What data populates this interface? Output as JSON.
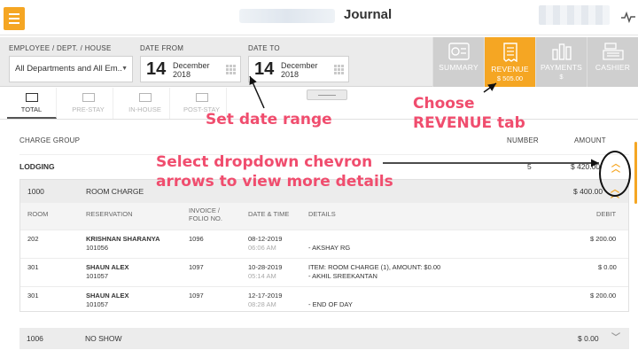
{
  "header": {
    "title": "Journal"
  },
  "filters": {
    "employee_label": "EMPLOYEE / DEPT. / HOUSE",
    "employee_value": "All Departments and All Em..",
    "date_from_label": "DATE FROM",
    "date_from_day": "14",
    "date_from_month": "December",
    "date_from_year": "2018",
    "date_to_label": "DATE TO",
    "date_to_day": "14",
    "date_to_month": "December",
    "date_to_year": "2018"
  },
  "report_tabs": [
    {
      "label": "SUMMARY",
      "sub": "",
      "icon": "summary-icon"
    },
    {
      "label": "REVENUE",
      "sub": "$ 505.00",
      "icon": "receipt-icon"
    },
    {
      "label": "PAYMENTS",
      "sub": "$",
      "icon": "bar-chart-icon"
    },
    {
      "label": "CASHIER",
      "sub": "",
      "icon": "cash-register-icon"
    }
  ],
  "sub_tabs": [
    "TOTAL",
    "PRE-STAY",
    "IN-HOUSE",
    "POST-STAY"
  ],
  "table": {
    "header_group": "CHARGE GROUP",
    "header_number": "NUMBER",
    "header_amount": "AMOUNT",
    "group": {
      "name": "LODGING",
      "number": "5",
      "amount": "$ 420.00"
    },
    "charge": {
      "code": "1000",
      "name": "ROOM CHARGE",
      "amount": "$ 400.00"
    },
    "columns": {
      "room": "ROOM",
      "reservation": "RESERVATION",
      "invoice": "INVOICE /",
      "folio": "FOLIO NO.",
      "datetime": "DATE & TIME",
      "details": "DETAILS",
      "debit": "DEBIT"
    },
    "rows": [
      {
        "room": "202",
        "guest": "KRISHNAN SHARANYA",
        "res_no": "101056",
        "invoice": "1096",
        "date": "08-12-2019",
        "time": "06:06 AM",
        "detail1": "",
        "detail2": "- AKSHAY RG",
        "debit": "$ 200.00"
      },
      {
        "room": "301",
        "guest": "SHAUN ALEX",
        "res_no": "101057",
        "invoice": "1097",
        "date": "10-28-2019",
        "time": "05:14 AM",
        "detail1": "ITEM: ROOM CHARGE (1), AMOUNT: $0.00",
        "detail2": "- AKHIL SREEKANTAN",
        "debit": "$ 0.00"
      },
      {
        "room": "301",
        "guest": "SHAUN ALEX",
        "res_no": "101057",
        "invoice": "1097",
        "date": "12-17-2019",
        "time": "08:28 AM",
        "detail1": "",
        "detail2": "- END OF DAY",
        "debit": "$ 200.00"
      }
    ],
    "noshow": {
      "code": "1006",
      "name": "NO SHOW",
      "amount": "$ 0.00"
    }
  },
  "annotations": {
    "date_range": "Set date range",
    "revenue_line1": "Choose",
    "revenue_line2": "REVENUE tab",
    "chevron_line1": "Select dropdown chevron",
    "chevron_line2": "arrows to view more details"
  },
  "colors": {
    "accent": "#f5a623",
    "annotation": "#f04d6e"
  }
}
